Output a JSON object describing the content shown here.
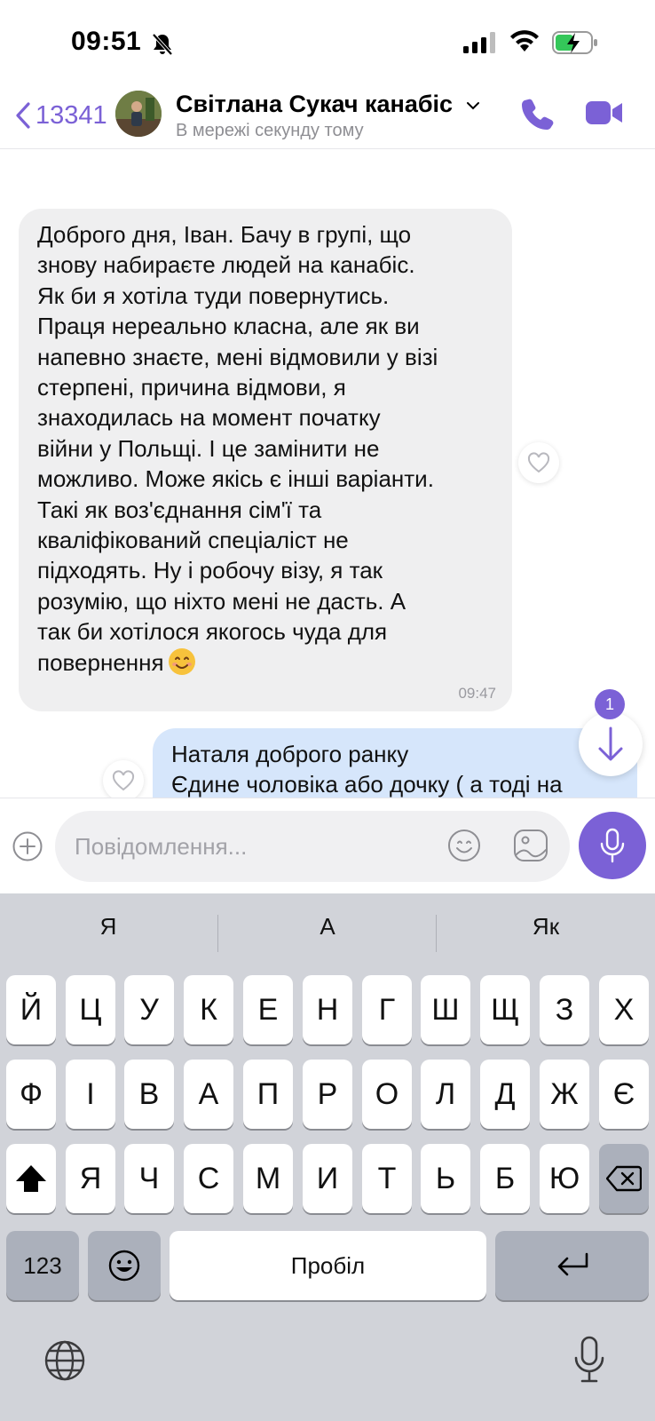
{
  "status_bar": {
    "time": "09:51"
  },
  "header": {
    "back_label": "13341",
    "contact_name": "Світлана Сукач канабіс",
    "contact_status": "В мережі секунду тому"
  },
  "messages": {
    "incoming": {
      "text": "Доброго дня, Іван. Бачу в групі, що\nзнову набираєте людей на канабіс.\nЯк би я хотіла туди повернутись.\nПраця нереально класна, але як ви\nнапевно знаєте, мені відмовили у візі\nстерпені, причина відмови, я\nзнаходилась на момент початку\nвійни у Польщі. І це замінити не\nможливо. Може якісь є інші варіанти.\nТакі як воз'єднання сім'ї та\nкваліфікований спеціаліст не\nпідходять. Ну і робочу візу, я так\nрозумію, що ніхто мені не дасть. А\nтак би хотілося якогось чуда для\nповернення",
      "time": "09:47"
    },
    "outgoing": {
      "text": "Наталя доброго ранку\nЄдине чоловіка або дочку ( а тоді на"
    },
    "unread_count": "1"
  },
  "composer": {
    "placeholder": "Повідомлення..."
  },
  "keyboard": {
    "suggestions": [
      "Я",
      "А",
      "Як"
    ],
    "row1": [
      "Й",
      "Ц",
      "У",
      "К",
      "Е",
      "Н",
      "Г",
      "Ш",
      "Щ",
      "З",
      "Х"
    ],
    "row2": [
      "Ф",
      "І",
      "В",
      "А",
      "П",
      "Р",
      "О",
      "Л",
      "Д",
      "Ж",
      "Є"
    ],
    "row3": [
      "Я",
      "Ч",
      "С",
      "М",
      "И",
      "Т",
      "Ь",
      "Б",
      "Ю"
    ],
    "numbers_label": "123",
    "space_label": "Пробіл"
  },
  "colors": {
    "accent": "#7b61d6",
    "incoming_bubble": "#efeff0",
    "outgoing_bubble": "#d6e6fb",
    "keyboard_bg": "#d1d3d9"
  }
}
